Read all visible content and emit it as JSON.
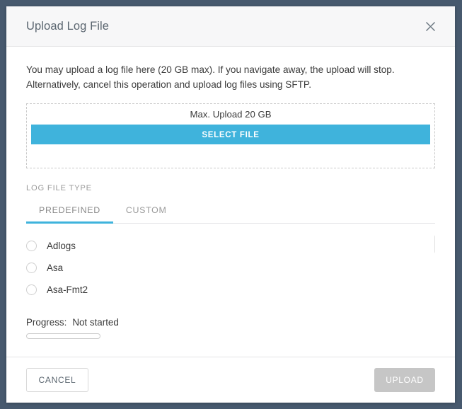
{
  "theme": {
    "backdrop": "#47596e",
    "accent": "#3fb3dc",
    "disabled": "#c6c6c6",
    "header_bg": "#f7f7f8",
    "text": "#3b3b3b",
    "muted": "#9a9a9a"
  },
  "dialog": {
    "title": "Upload Log File",
    "close_icon": "close-icon",
    "description_line1": "You may upload a log file here (20 GB max). If you navigate away, the upload will stop.",
    "description_line2": "Alternatively, cancel this operation and upload log files using SFTP."
  },
  "dropzone": {
    "max_upload_label": "Max. Upload 20 GB",
    "select_file_label": "SELECT FILE"
  },
  "log_file_type": {
    "section_label": "LOG FILE TYPE",
    "tabs": [
      {
        "label": "PREDEFINED",
        "active": true
      },
      {
        "label": "CUSTOM",
        "active": false
      }
    ],
    "options": [
      {
        "label": "Adlogs",
        "selected": false
      },
      {
        "label": "Asa",
        "selected": false
      },
      {
        "label": "Asa-Fmt2",
        "selected": false
      }
    ]
  },
  "progress": {
    "label": "Progress:",
    "status": "Not started",
    "percent": 0
  },
  "footer": {
    "cancel_label": "CANCEL",
    "upload_label": "UPLOAD"
  }
}
